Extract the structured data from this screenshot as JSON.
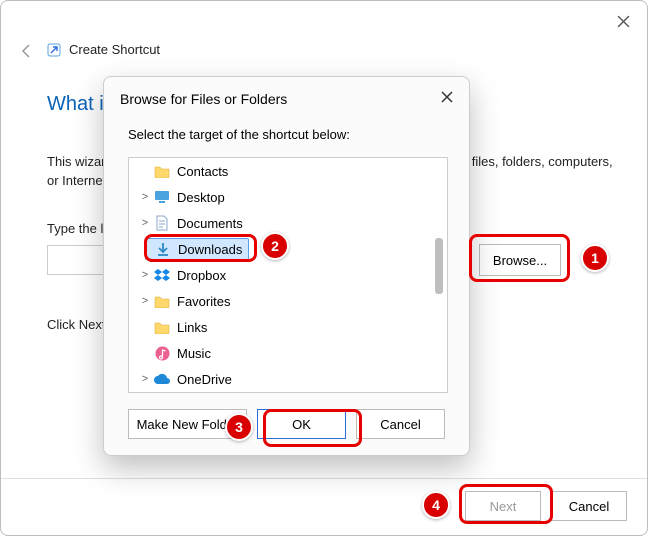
{
  "wizard": {
    "title": "Create Shortcut",
    "heading_prefix": "What ite",
    "desc_prefix": "This wizard",
    "desc_suffix": ", files, folders, computers, or Internet",
    "type_label": "Type the lo",
    "browse_label": "Browse...",
    "click_next": "Click Next",
    "next_label": "Next",
    "cancel_label": "Cancel"
  },
  "dialog": {
    "title": "Browse for Files or Folders",
    "subtitle": "Select the target of the shortcut below:",
    "make_new_folder": "Make New Folder",
    "ok_label": "OK",
    "cancel_label": "Cancel",
    "items": [
      {
        "expander": "",
        "icon": "folder",
        "label": "Contacts"
      },
      {
        "expander": ">",
        "icon": "desktop",
        "label": "Desktop"
      },
      {
        "expander": ">",
        "icon": "doc",
        "label": "Documents"
      },
      {
        "expander": "",
        "icon": "down",
        "label": "Downloads",
        "selected": true
      },
      {
        "expander": ">",
        "icon": "dropbox",
        "label": "Dropbox"
      },
      {
        "expander": ">",
        "icon": "folder",
        "label": "Favorites"
      },
      {
        "expander": "",
        "icon": "folder",
        "label": "Links"
      },
      {
        "expander": "",
        "icon": "music",
        "label": "Music"
      },
      {
        "expander": ">",
        "icon": "cloud",
        "label": "OneDrive"
      }
    ]
  },
  "annotations": {
    "b1": "1",
    "b2": "2",
    "b3": "3",
    "b4": "4"
  }
}
